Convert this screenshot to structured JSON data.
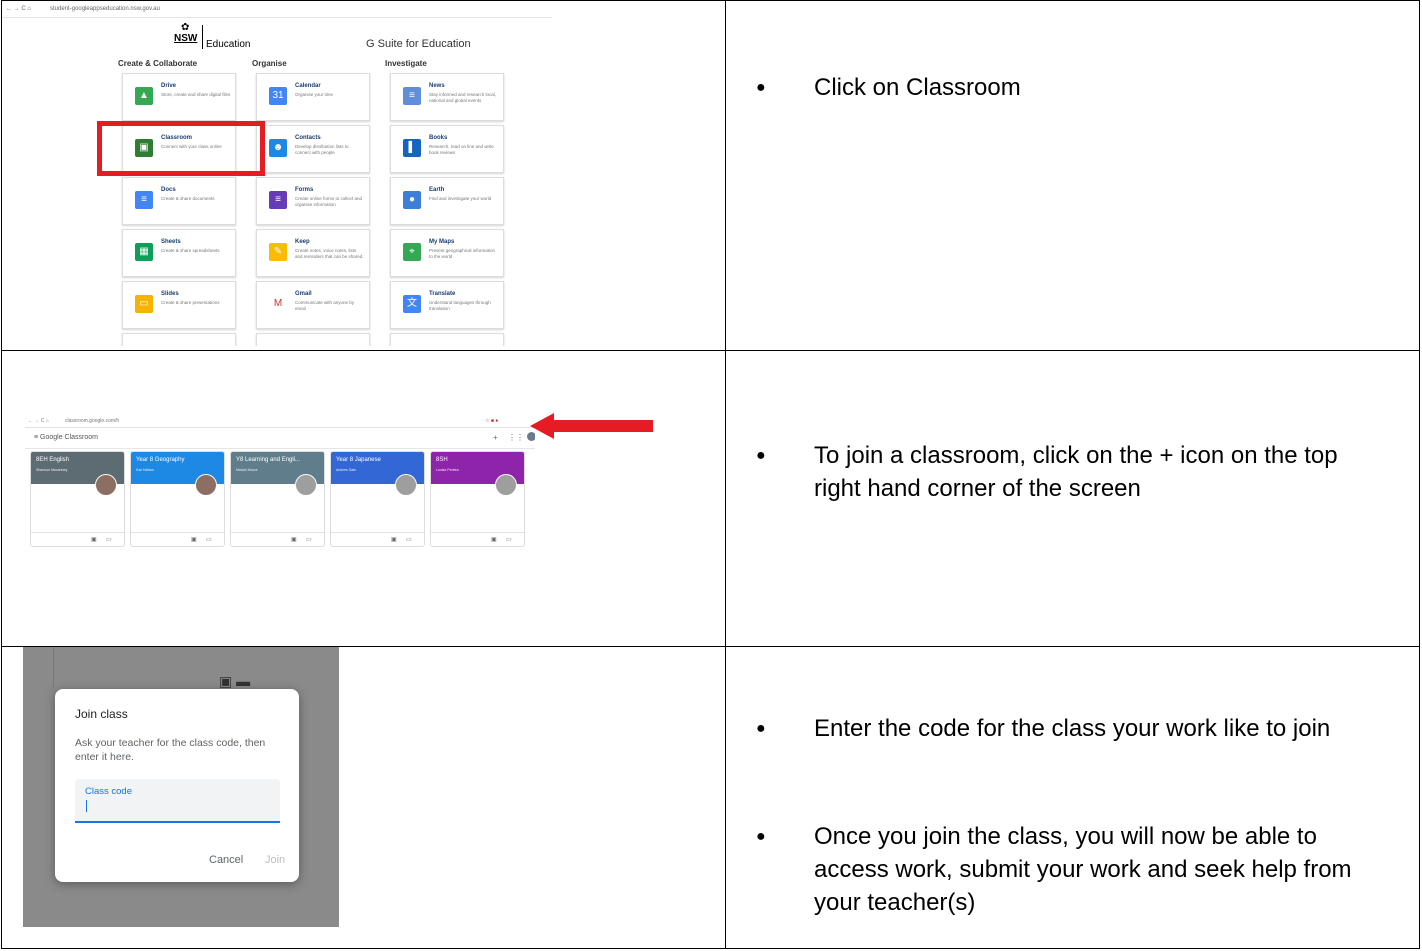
{
  "portal": {
    "address": "student-googleappseducation.nsw.gov.au",
    "logo_nsw": "NSW",
    "logo_education": "Education",
    "gsuite": "G Suite for Education",
    "columns": [
      "Create & Collaborate",
      "Organise",
      "Investigate"
    ],
    "tiles": [
      {
        "name": "Drive",
        "desc": "Store, create and share digital files",
        "color": "#34a853",
        "glyph": "▲"
      },
      {
        "name": "Calendar",
        "desc": "Organise your time",
        "color": "#4285f4",
        "glyph": "31"
      },
      {
        "name": "News",
        "desc": "Stay informed and research local, national and global events",
        "color": "#5f8fd8",
        "glyph": "≡"
      },
      {
        "name": "Classroom",
        "desc": "Connect with your class online",
        "color": "#2e7d32",
        "glyph": "▣"
      },
      {
        "name": "Contacts",
        "desc": "Develop distribution lists to connect with people",
        "color": "#1e88e5",
        "glyph": "☻"
      },
      {
        "name": "Books",
        "desc": "Research, read on line and write book reviews",
        "color": "#1565c0",
        "glyph": "▌"
      },
      {
        "name": "Docs",
        "desc": "Create & share documents",
        "color": "#4285f4",
        "glyph": "≡"
      },
      {
        "name": "Forms",
        "desc": "Create online forms to collect and organise information",
        "color": "#673ab7",
        "glyph": "≡"
      },
      {
        "name": "Earth",
        "desc": "Find and investigate your world",
        "color": "#3b7fd9",
        "glyph": "●"
      },
      {
        "name": "Sheets",
        "desc": "Create & share spreadsheets",
        "color": "#0f9d58",
        "glyph": "▦"
      },
      {
        "name": "Keep",
        "desc": "Create notes, voice notes, lists and reminders that can be shared.",
        "color": "#fbbc04",
        "glyph": "✎"
      },
      {
        "name": "My Maps",
        "desc": "Present geographical information to the world",
        "color": "#34a853",
        "glyph": "⌖"
      },
      {
        "name": "Slides",
        "desc": "Create & share presentations",
        "color": "#f4b400",
        "glyph": "▭"
      },
      {
        "name": "Gmail",
        "desc": "Communicate with anyone by email",
        "color": "#ffffff",
        "glyph": "M"
      },
      {
        "name": "Translate",
        "desc": "Understand languages through translation",
        "color": "#4285f4",
        "glyph": "文"
      }
    ]
  },
  "classroom": {
    "address": "classroom.google.com/h",
    "logo": "Google Classroom",
    "cards": [
      {
        "name": "8EH English",
        "teacher": "Shannon Macartney",
        "color": "#5d6b73"
      },
      {
        "name": "Year 8 Geography",
        "teacher": "Karl Nelson",
        "color": "#1e88e5"
      },
      {
        "name": "Y8 Learning and Engli...",
        "teacher": "Mariah Moore",
        "color": "#607d8b"
      },
      {
        "name": "Year 8 Japanese",
        "teacher": "Andrew Sato",
        "color": "#3367d6"
      },
      {
        "name": "8SH",
        "teacher": "Louise Pereira",
        "color": "#8e24aa"
      }
    ]
  },
  "join_dialog": {
    "title": "Join class",
    "description": "Ask your teacher for the class code, then enter it here.",
    "field_label": "Class code",
    "cancel": "Cancel",
    "join": "Join"
  },
  "instructions": {
    "row1": [
      "Click on Classroom"
    ],
    "row2": [
      "To join a classroom, click on the + icon on the top right hand corner of the screen"
    ],
    "row3": [
      "Enter the code for the class your work like to join",
      "Once you join the class, you will now be able to access work, submit your work and seek help from your teacher(s)"
    ]
  },
  "colors": {
    "highlight_red": "#e51c23",
    "arrow_red": "#e51c23",
    "accent_blue": "#1a73e8"
  }
}
